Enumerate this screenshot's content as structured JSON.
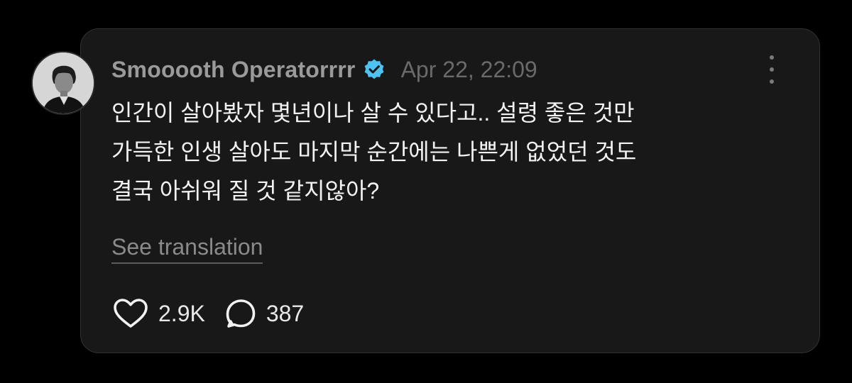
{
  "post": {
    "author": {
      "username": "Smooooth Operatorrrr",
      "verified": true
    },
    "timestamp": "Apr 22, 22:09",
    "text_lines": [
      "인간이 살아봤자 몇년이나 살 수 있다고.. 설령 좋은 것만",
      "가득한 인생 살아도 마지막 순간에는 나쁜게 없었던 것도",
      "결국 아쉬워 질 것 같지않아?"
    ],
    "translate_label": "See translation",
    "likes": "2.9K",
    "replies": "387"
  },
  "icons": {
    "verified": "verified-badge-icon",
    "more": "more-vertical-icon",
    "like": "heart-outline-icon",
    "reply": "speech-bubble-icon"
  },
  "colors": {
    "background": "#000000",
    "card": "#181818",
    "verified_badge": "#4cc3f0",
    "text": "#f2f2f2",
    "muted": "#9a9a9a"
  }
}
